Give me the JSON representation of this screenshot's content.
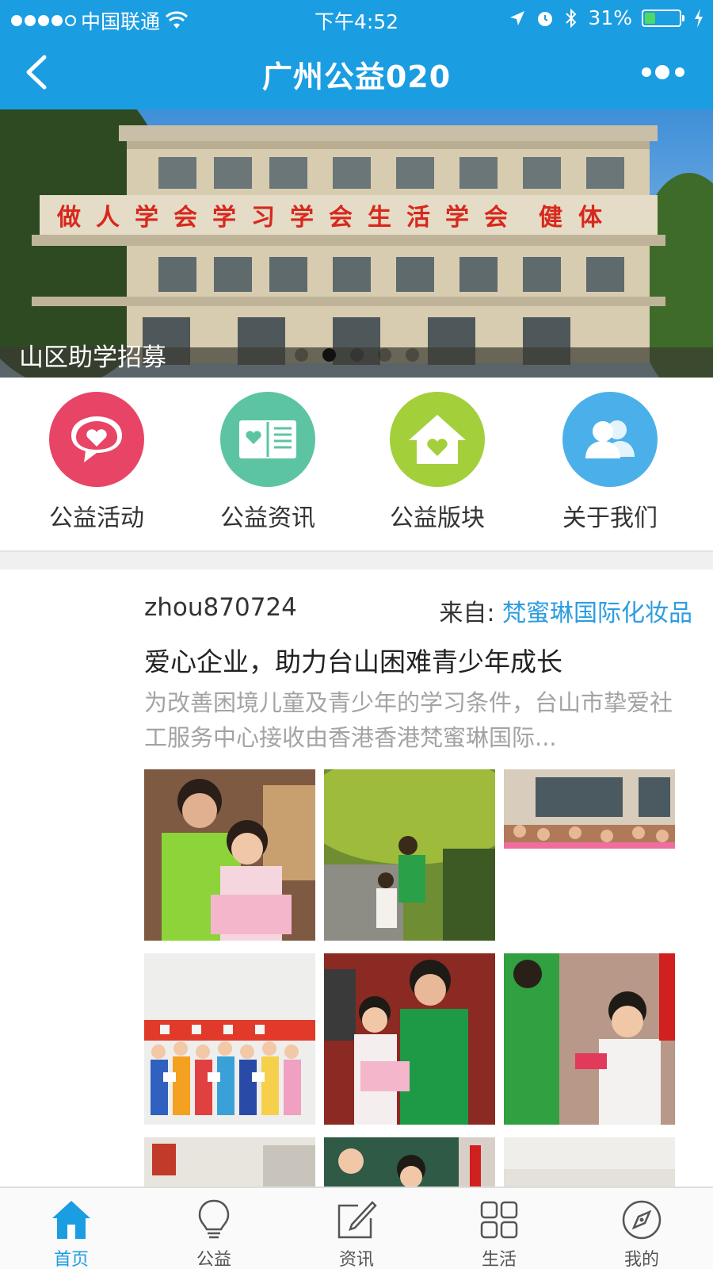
{
  "status_bar": {
    "carrier": "中国联通",
    "time": "下午4:52",
    "battery": "31%",
    "battery_level": 0.31
  },
  "nav": {
    "title": "广州公益020"
  },
  "banner": {
    "caption": "山区助学招募",
    "slide_count": 5,
    "active_slide": 2,
    "sign_text": "做人学会学习学会生活学会健体"
  },
  "categories": [
    {
      "label": "公益活动",
      "icon": "chat-heart-icon",
      "color": "#e84466"
    },
    {
      "label": "公益资讯",
      "icon": "open-book-icon",
      "color": "#5cc4a2"
    },
    {
      "label": "公益版块",
      "icon": "house-heart-icon",
      "color": "#a3cf3b"
    },
    {
      "label": "关于我们",
      "icon": "users-icon",
      "color": "#4bb0ea"
    }
  ],
  "post": {
    "author": "zhou870724",
    "source_prefix": "来自:",
    "source_name": "梵蜜琳国际化妆品",
    "headline": "爱心企业，助力台山困难青少年成长",
    "summary": "为改善困境儿童及青少年的学习条件，台山市挚爱社工服务中心接收由香港香港梵蜜琳国际..."
  },
  "tabs": [
    {
      "label": "首页",
      "icon": "home-icon",
      "active": true
    },
    {
      "label": "公益",
      "icon": "lightbulb-icon",
      "active": false
    },
    {
      "label": "资讯",
      "icon": "edit-icon",
      "active": false
    },
    {
      "label": "生活",
      "icon": "grid-icon",
      "active": false
    },
    {
      "label": "我的",
      "icon": "compass-icon",
      "active": false
    }
  ],
  "colors": {
    "primary": "#1b9de2",
    "link": "#2c9de0"
  }
}
